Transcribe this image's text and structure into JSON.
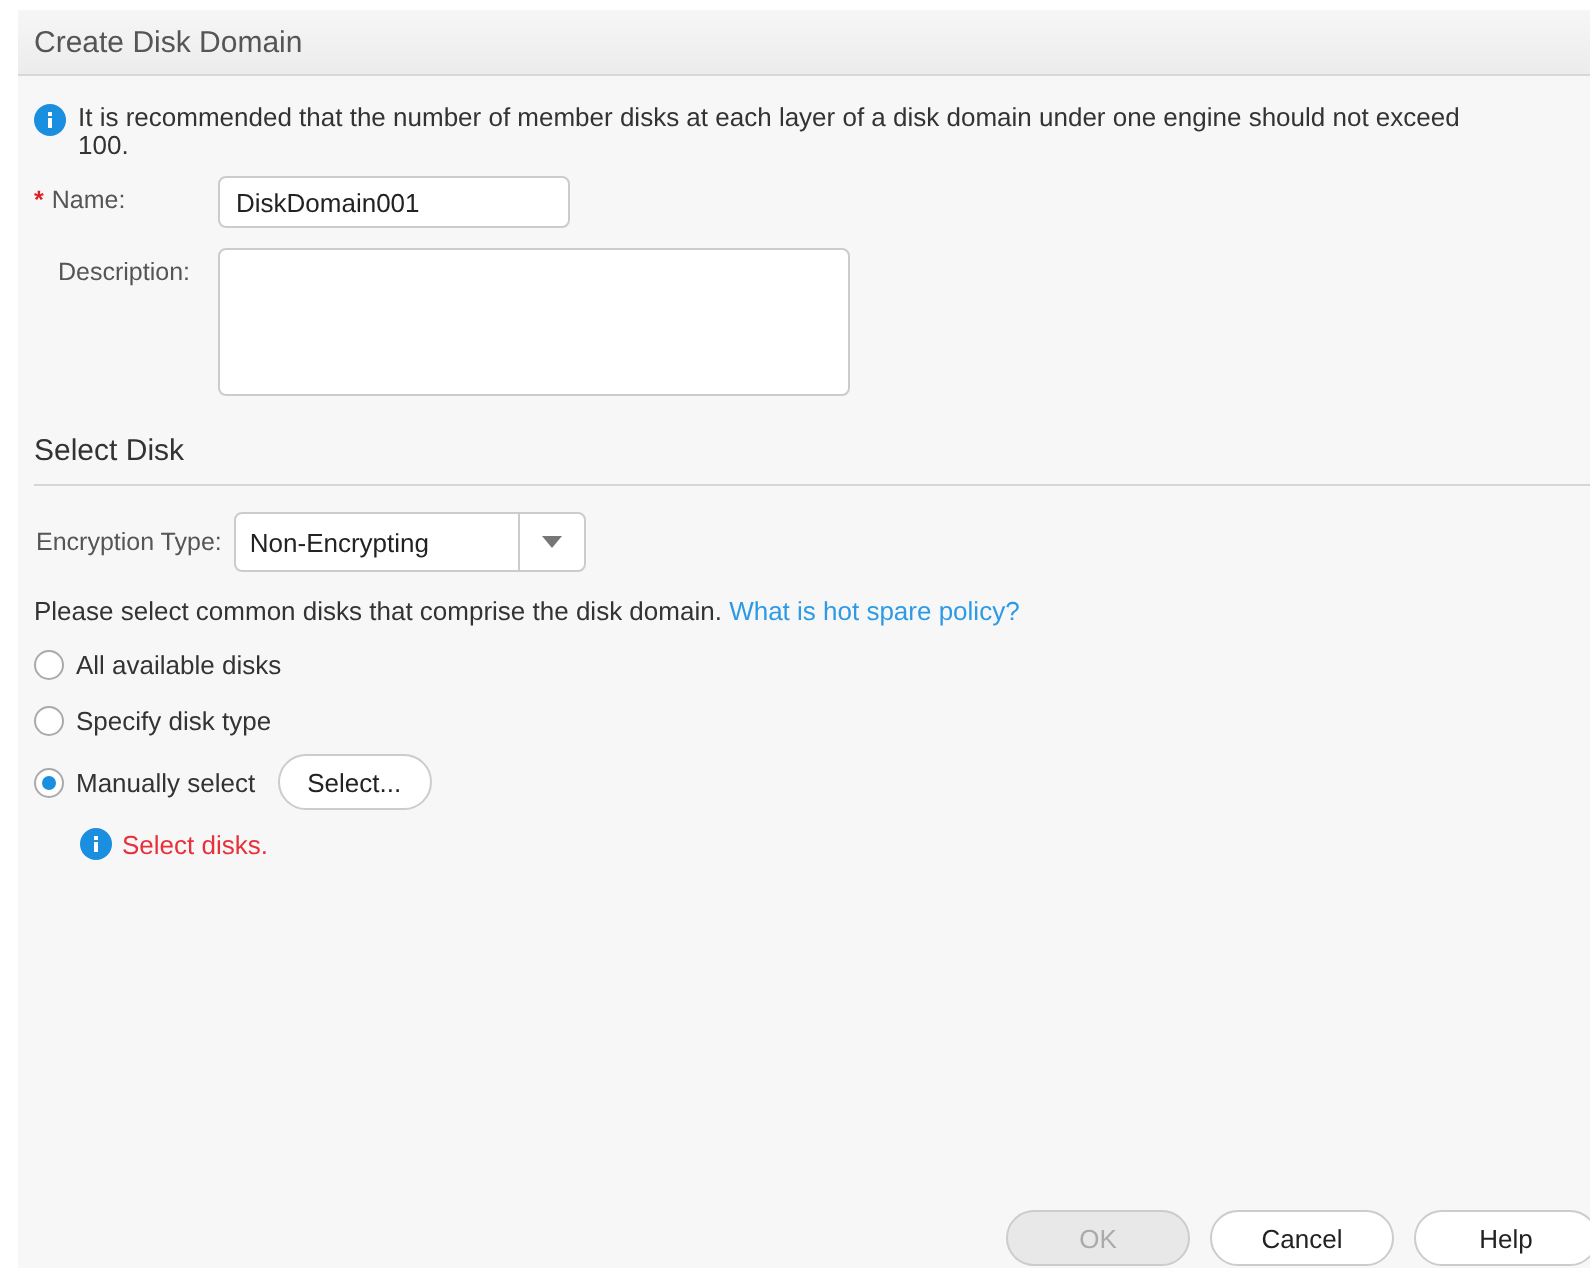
{
  "window": {
    "title": "Create Disk Domain"
  },
  "notice": "It is recommended that the number of member disks at each layer of a disk domain under one engine should not exceed 100.",
  "fields": [
    {
      "label": "Name:",
      "required_mark": "*",
      "kind": "text",
      "value": "DiskDomain001"
    },
    {
      "label": "Description:",
      "kind": "textarea"
    }
  ],
  "section": {
    "title": "Select Disk"
  },
  "encryption": {
    "label": "Encryption Type:",
    "value": "Non-Encrypting"
  },
  "prompt": {
    "text": "Please select common disks that comprise the disk domain.",
    "link": "What is hot spare policy?"
  },
  "options": [
    {
      "label": "All available disks",
      "selected": false
    },
    {
      "label": "Specify disk type",
      "selected": false
    },
    {
      "label": "Manually select",
      "selected": true,
      "button": "Select..."
    }
  ],
  "error": "Select disks.",
  "buttons": [
    {
      "label": "OK",
      "disabled": true
    },
    {
      "label": "Cancel",
      "disabled": false
    },
    {
      "label": "Help",
      "disabled": false
    }
  ]
}
